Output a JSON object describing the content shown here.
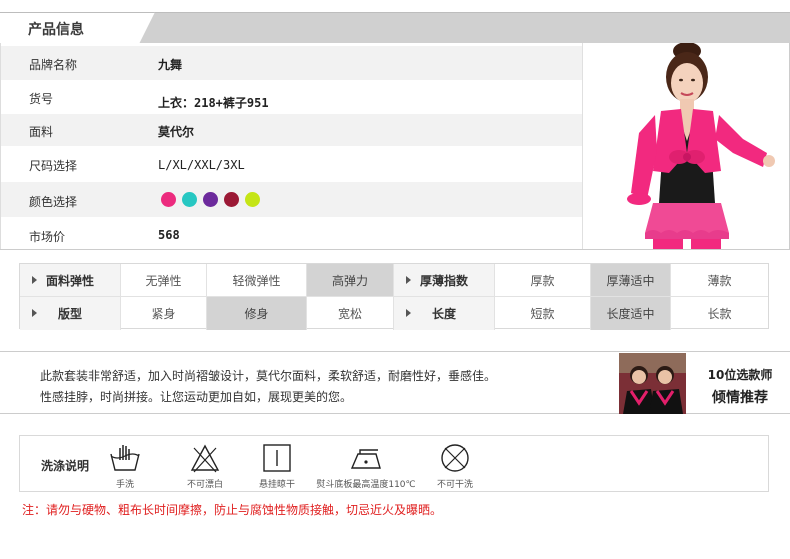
{
  "header": {
    "title": "产品信息"
  },
  "info": {
    "brand_label": "品牌名称",
    "brand_value": "九舞",
    "sku_label": "货号",
    "sku_value": "上衣：218+裤子951",
    "fabric_label": "面料",
    "fabric_value": "莫代尔",
    "size_label": "尺码选择",
    "size_value": "L/XL/XXL/3XL",
    "color_label": "颜色选择",
    "colors": [
      "#ec2b7e",
      "#27c7c2",
      "#6c2a9c",
      "#9b1935",
      "#c5e516"
    ],
    "price_label": "市场价",
    "price_value": "568"
  },
  "attrs": {
    "row1": [
      "面料弹性",
      "无弹性",
      "轻微弹性",
      "高弹力",
      "厚薄指数",
      "厚款",
      "厚薄适中",
      "薄款"
    ],
    "row2": [
      "版型",
      "紧身",
      "修身",
      "宽松",
      "长度",
      "短款",
      "长度适中",
      "长款"
    ]
  },
  "desc": {
    "line1": "此款套装非常舒适，加入时尚褶皱设计，莫代尔面料，柔软舒适，耐磨性好，垂感佳。",
    "line2": "性感挂脖，时尚拼接。让您运动更加自如，展现更美的您。",
    "rec_line1": "10位选款师",
    "rec_line2": "倾情推荐"
  },
  "wash": {
    "label": "洗涤说明",
    "items": [
      "手洗",
      "不可漂白",
      "悬挂晾干",
      "熨斗底板最高温度110℃",
      "不可干洗"
    ]
  },
  "note": "注：请勿与硬物、粗布长时间摩擦，防止与腐蚀性物质接触，切忌近火及曝晒。"
}
